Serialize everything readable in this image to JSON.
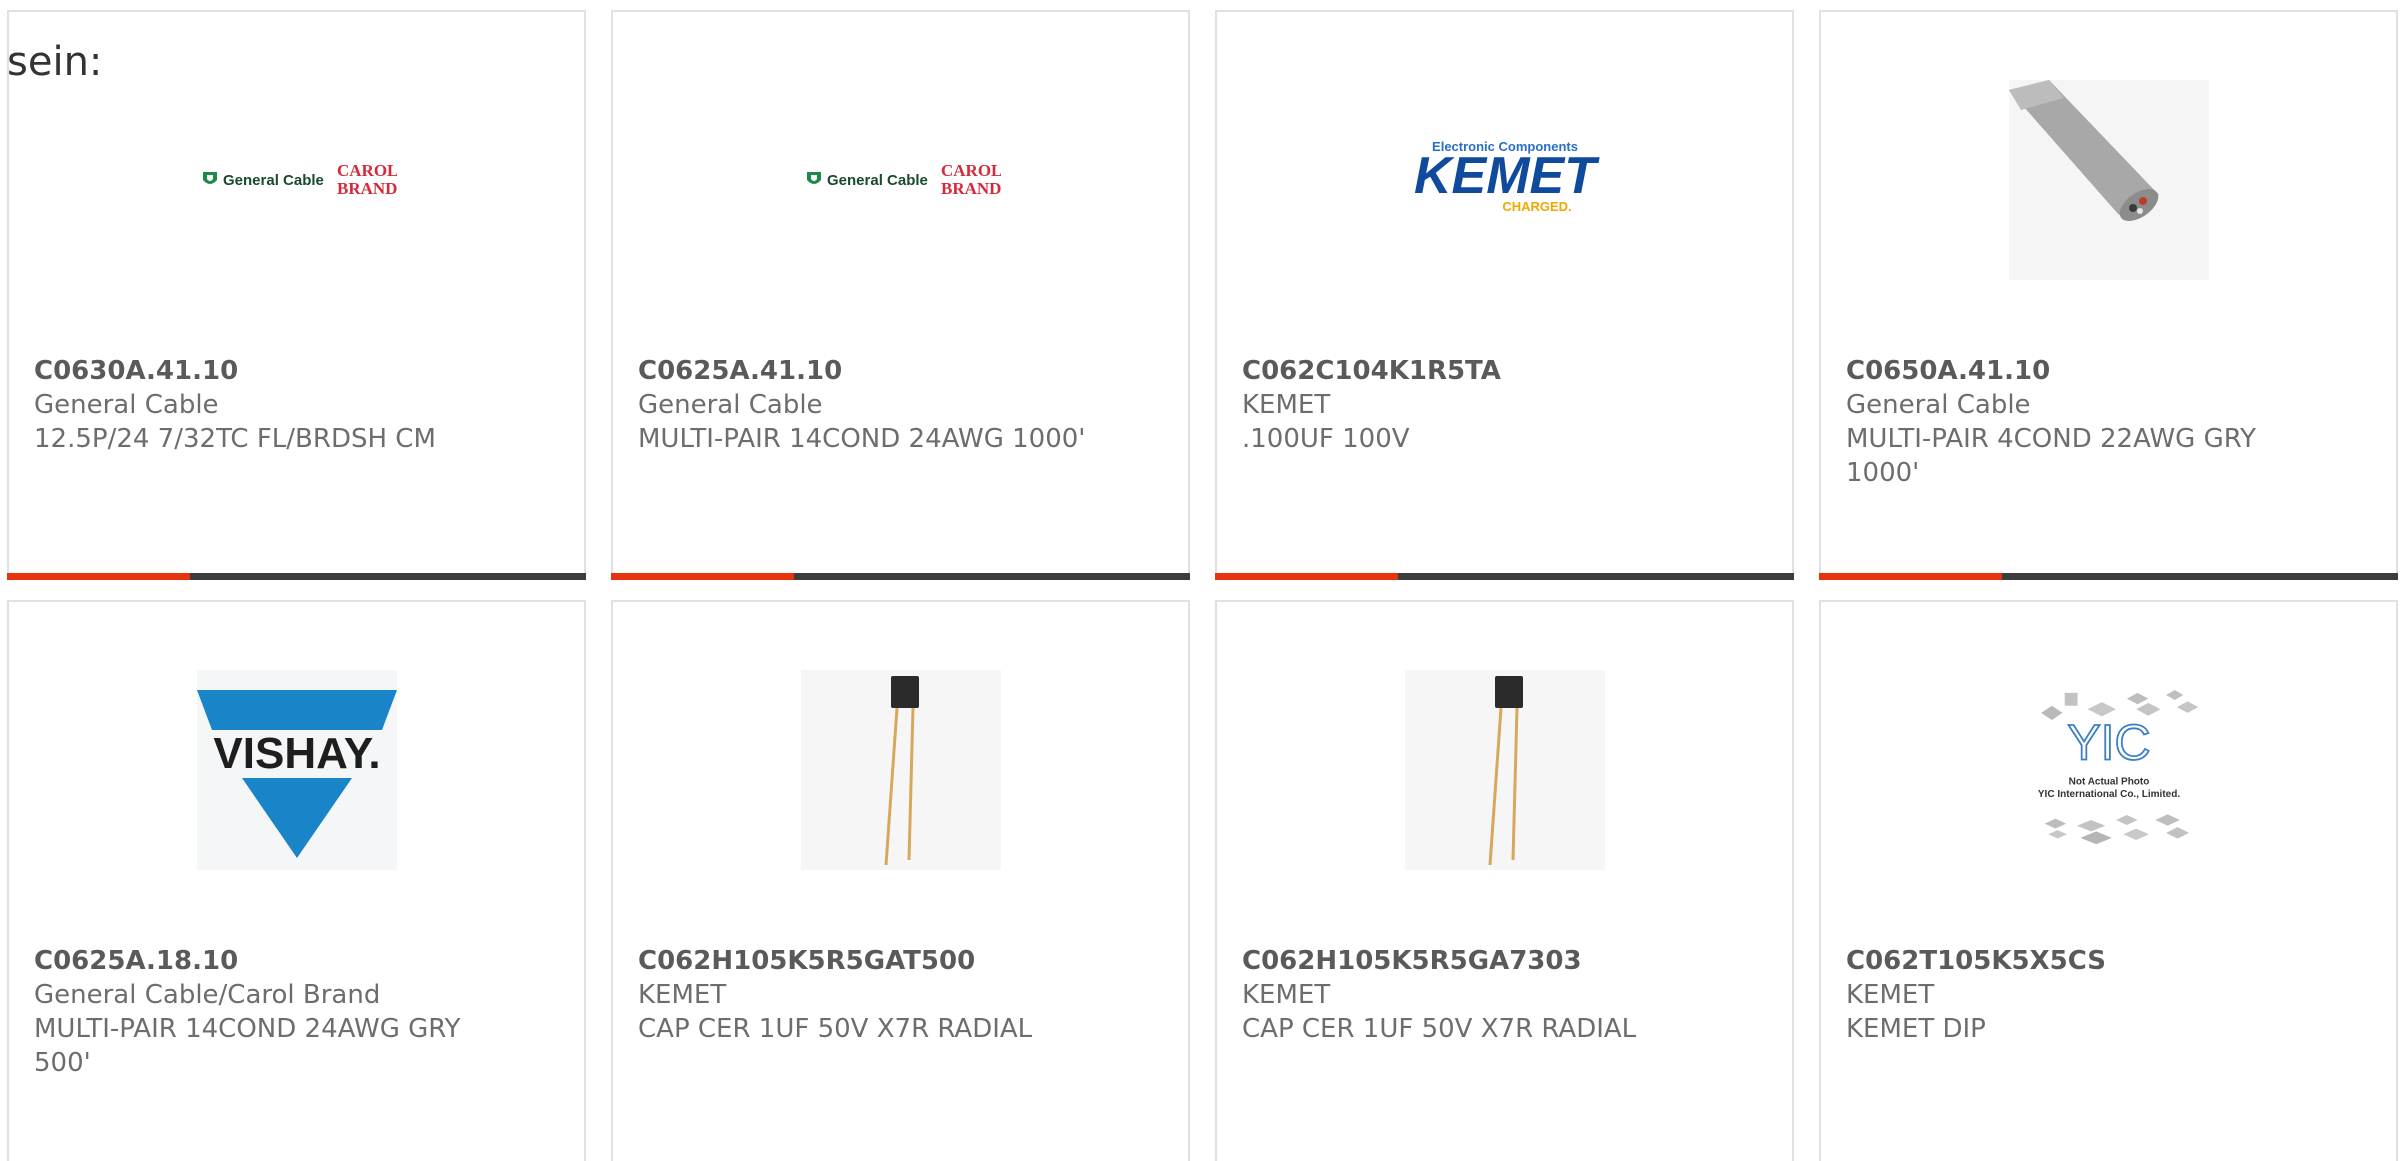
{
  "intro_text": "sein:",
  "colors": {
    "accent": "#e8340e",
    "bar": "#3d3d3d",
    "card_border": "#e1e1e1",
    "text": "#6d6d6d"
  },
  "products": [
    {
      "part": "C0630A.41.10",
      "brand": "General Cable",
      "description": "12.5P/24 7/32TC FL/BRDSH CM",
      "image": "general-cable-carol-brand-logo",
      "logo_text": [
        "General Cable",
        "CAROL",
        "BRAND"
      ]
    },
    {
      "part": "C0625A.41.10",
      "brand": "General Cable",
      "description": "MULTI-PAIR 14COND 24AWG 1000'",
      "image": "general-cable-carol-brand-logo",
      "logo_text": [
        "General Cable",
        "CAROL",
        "BRAND"
      ]
    },
    {
      "part": "C062C104K1R5TA",
      "brand": "KEMET",
      "description": ".100UF 100V",
      "image": "kemet-logo",
      "logo_text": [
        "Electronic Components",
        "KEMET",
        "CHARGED."
      ]
    },
    {
      "part": "C0650A.41.10",
      "brand": "General Cable",
      "description": "MULTI-PAIR 4COND 22AWG GRY 1000'",
      "image": "gray-cable-photo"
    },
    {
      "part": "C0625A.18.10",
      "brand": "General Cable/Carol Brand",
      "description": "MULTI-PAIR 14COND 24AWG GRY 500'",
      "image": "vishay-logo",
      "logo_text": [
        "VISHAY."
      ]
    },
    {
      "part": "C062H105K5R5GAT500",
      "brand": "KEMET",
      "description": "CAP CER 1UF 50V X7R RADIAL",
      "image": "radial-capacitor-photo"
    },
    {
      "part": "C062H105K5R5GA7303",
      "brand": "KEMET",
      "description": "CAP CER 1UF 50V X7R RADIAL",
      "image": "radial-capacitor-photo"
    },
    {
      "part": "C062T105K5X5CS",
      "brand": "KEMET",
      "description": "KEMET DIP",
      "image": "yic-not-actual-photo",
      "logo_text": [
        "Not Actual Photo",
        "YIC International Co., Limited."
      ]
    }
  ]
}
